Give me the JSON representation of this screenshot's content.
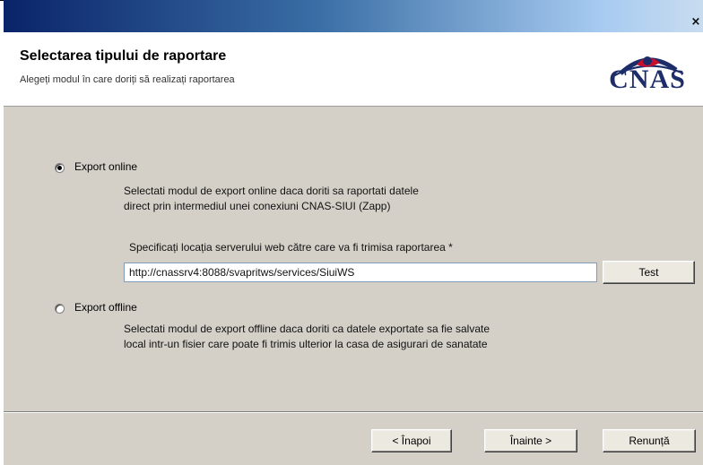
{
  "window": {
    "close_glyph": "×"
  },
  "header": {
    "title": "Selectarea tipului de raportare",
    "subtitle": "Alegeți modul în care doriți să realizați raportarea",
    "logo_text": "CNAS"
  },
  "options": {
    "online": {
      "label": "Export online",
      "selected": true,
      "desc_line1": "Selectati modul de export online daca doriti sa raportati datele",
      "desc_line2": "direct prin intermediul unei conexiuni CNAS-SIUI (Zapp)",
      "server_label": "Specificați locația serverului web către care va fi trimisa raportarea *",
      "server_value": "http://cnassrv4:8088/svapritws/services/SiuiWS",
      "test_button": "Test"
    },
    "offline": {
      "label": "Export offline",
      "selected": false,
      "desc_line1": "Selectati modul de export offline daca doriti ca datele exportate sa fie salvate",
      "desc_line2": "local intr-un fisier care poate fi trimis ulterior la casa de asigurari de sanatate"
    }
  },
  "footer": {
    "back_button": "< Înapoi",
    "next_button": "Înainte >",
    "cancel_button": "Renunță"
  },
  "colors": {
    "logo_blue": "#1d2d6a",
    "logo_red": "#c8102e",
    "dialog_bg": "#d4d0c8"
  }
}
